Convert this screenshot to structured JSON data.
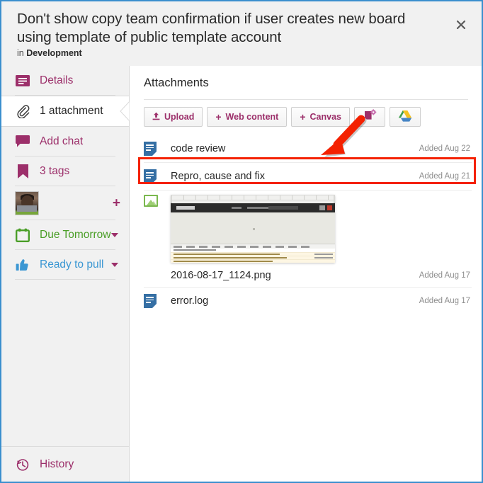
{
  "window": {
    "border_color": "#3a8fce",
    "accent_color": "#9c2f6a",
    "highlight_color": "#f42100"
  },
  "header": {
    "title": "Don't show copy team confirmation if user creates new board using template of public template account",
    "subtitle_prefix": "in ",
    "subtitle_board": "Development",
    "close_icon": "close-icon",
    "close_label": "Close"
  },
  "sidebar": {
    "items": [
      {
        "label": "Details",
        "icon": "details-icon",
        "color": "magenta",
        "active": false
      },
      {
        "label": "1 attachment",
        "icon": "paperclip-icon",
        "color": "dark",
        "active": true
      },
      {
        "label": "Add chat",
        "icon": "chat-icon",
        "color": "magenta",
        "active": false
      },
      {
        "label": "3 tags",
        "icon": "tag-icon",
        "color": "magenta",
        "active": false
      }
    ],
    "members": {
      "avatar_name": "member-avatar",
      "add_member_label": "+"
    },
    "due": {
      "label": "Due Tomorrow",
      "icon": "calendar-icon",
      "color": "#4a9e27"
    },
    "status": {
      "label": "Ready to pull",
      "icon": "thumbs-up-icon",
      "color": "#3b97d3"
    },
    "history": {
      "label": "History",
      "icon": "history-clock-icon"
    }
  },
  "content": {
    "title": "Attachments",
    "toolbar": [
      {
        "label": "Upload",
        "icon": "upload-icon",
        "name": "upload-button"
      },
      {
        "label": "Web content",
        "icon": "plus-icon",
        "name": "web-content-button"
      },
      {
        "label": "Canvas",
        "icon": "plus-icon",
        "name": "canvas-button"
      },
      {
        "label": "",
        "icon": "document-gear-icon",
        "name": "document-template-button"
      },
      {
        "label": "",
        "icon": "google-drive-icon",
        "name": "google-drive-button"
      }
    ],
    "attachments": [
      {
        "name": "code review",
        "date": "Added Aug 22",
        "icon": "document-icon",
        "type": "doc"
      },
      {
        "name": "Repro, cause and fix",
        "date": "Added Aug 21",
        "icon": "document-icon",
        "type": "doc",
        "highlighted": true
      },
      {
        "name": "2016-08-17_1124.png",
        "date": "Added Aug 17",
        "icon": "image-icon",
        "type": "image"
      },
      {
        "name": "error.log",
        "date": "Added Aug 17",
        "icon": "document-icon",
        "type": "doc"
      }
    ]
  },
  "annotations": {
    "arrow": {
      "name": "red-arrow-pointer",
      "color": "#f42100"
    },
    "box": {
      "name": "red-highlight-box",
      "color": "#f42100"
    }
  }
}
